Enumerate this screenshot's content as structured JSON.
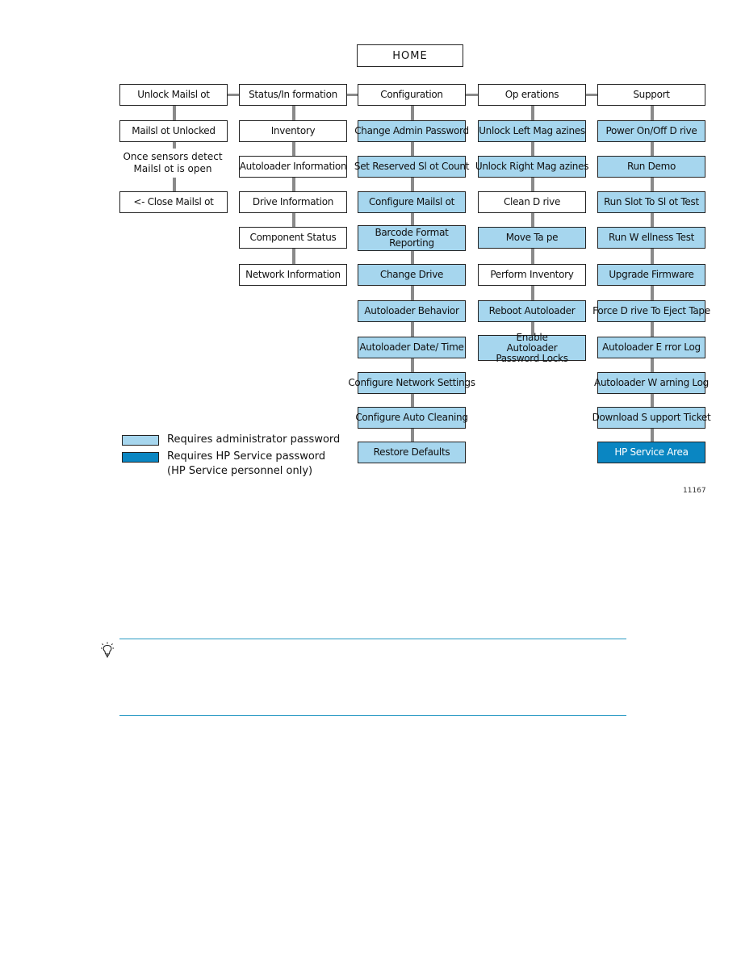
{
  "diagram": {
    "home": "HOME",
    "columns": [
      {
        "header": "Unlock Mailsl ot",
        "items": [
          {
            "label": "Mailsl ot Unlocked",
            "type": "normal"
          },
          {
            "label": "<- Close Mailsl ot",
            "type": "normal"
          }
        ],
        "note": "Once  sensors detect Mailsl ot is open"
      },
      {
        "header": "Status/In formation",
        "items": [
          {
            "label": "Inventory",
            "type": "normal"
          },
          {
            "label": "Autoloader Information",
            "type": "normal"
          },
          {
            "label": "Drive Information",
            "type": "normal"
          },
          {
            "label": "Component Status",
            "type": "normal"
          },
          {
            "label": "Network Information",
            "type": "normal"
          }
        ]
      },
      {
        "header": "Configuration",
        "items": [
          {
            "label": "Change Admin Password",
            "type": "admin"
          },
          {
            "label": "Set Reserved Sl ot Count",
            "type": "admin"
          },
          {
            "label": "Configure Mailsl ot",
            "type": "admin"
          },
          {
            "label": "Barcode Format Reporting",
            "type": "admin"
          },
          {
            "label": "Change Drive",
            "type": "admin"
          },
          {
            "label": "Autoloader Behavior",
            "type": "admin"
          },
          {
            "label": "Autoloader Date/ Time",
            "type": "admin"
          },
          {
            "label": "Configure Network Settings",
            "type": "admin"
          },
          {
            "label": "Configure Auto Cleaning",
            "type": "admin"
          },
          {
            "label": "Restore Defaults",
            "type": "admin"
          }
        ]
      },
      {
        "header": "Op erations",
        "items": [
          {
            "label": "Unlock Left Mag azines",
            "type": "admin"
          },
          {
            "label": "Unlock Right Mag azines",
            "type": "admin"
          },
          {
            "label": "Clean D rive",
            "type": "normal"
          },
          {
            "label": "Move Ta pe",
            "type": "admin"
          },
          {
            "label": "Perform Inventory",
            "type": "normal"
          },
          {
            "label": "Reboot Autoloader",
            "type": "admin"
          },
          {
            "label": "Enable Autoloader Password Locks",
            "type": "admin"
          }
        ]
      },
      {
        "header": "Support",
        "items": [
          {
            "label": "Power On/Off D   rive",
            "type": "admin"
          },
          {
            "label": "Run Demo",
            "type": "admin"
          },
          {
            "label": "Run Slot To Sl ot Test",
            "type": "admin"
          },
          {
            "label": "Run W ellness Test",
            "type": "admin"
          },
          {
            "label": "Upgrade  Firmware",
            "type": "admin"
          },
          {
            "label": "Force D rive To Eject Tape",
            "type": "admin"
          },
          {
            "label": "Autoloader E rror Log",
            "type": "admin"
          },
          {
            "label": "Autoloader W arning Log",
            "type": "admin"
          },
          {
            "label": "Download S upport Ticket",
            "type": "admin"
          },
          {
            "label": "HP Service Area",
            "type": "hp"
          }
        ]
      }
    ],
    "legend": [
      {
        "label": "Requires administrator password",
        "color": "#a6d6ee"
      },
      {
        "label": "Requires HP Service password",
        "sublabel": "(HP Service personnel only)",
        "color": "#0a86c2"
      }
    ],
    "figure_number": "11167"
  },
  "tip": {
    "icon": "lightbulb-icon",
    "text": ""
  }
}
